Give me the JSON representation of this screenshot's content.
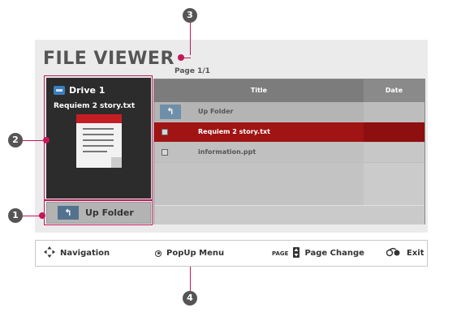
{
  "header": {
    "title": "FILE VIEWER",
    "page_indicator": "Page 1/1"
  },
  "preview": {
    "drive_label": "Drive 1",
    "selected_file": "Requiem 2 story.txt",
    "drive_icon": "drive-icon",
    "document_icon": "text-document-icon"
  },
  "up_folder_button": {
    "label": "Up Folder",
    "icon": "up-folder-icon",
    "icon_glyph": "↰"
  },
  "file_list": {
    "columns": [
      "Title",
      "Date"
    ],
    "rows": [
      {
        "label": "Up Folder",
        "type": "folder-up",
        "icon_glyph": "↰",
        "date": "",
        "selected": false
      },
      {
        "label": "Requiem 2 story.txt",
        "type": "file",
        "date": "",
        "selected": true
      },
      {
        "label": "information.ppt",
        "type": "file",
        "date": "",
        "selected": false
      }
    ]
  },
  "navbar": {
    "navigation": {
      "icon_glyph": "⇡",
      "label": "Navigation"
    },
    "popup_menu": {
      "label": "PopUp  Menu"
    },
    "page_change": {
      "key": "PAGE",
      "label": "Page  Change"
    },
    "exit": {
      "icon_glyph": "ᕱ",
      "label": "Exit"
    }
  },
  "callouts": [
    "1",
    "2",
    "3",
    "4"
  ],
  "colors": {
    "accent_selected": "#a01414",
    "callout_line": "#c2185b",
    "callout_badge": "#555555"
  }
}
